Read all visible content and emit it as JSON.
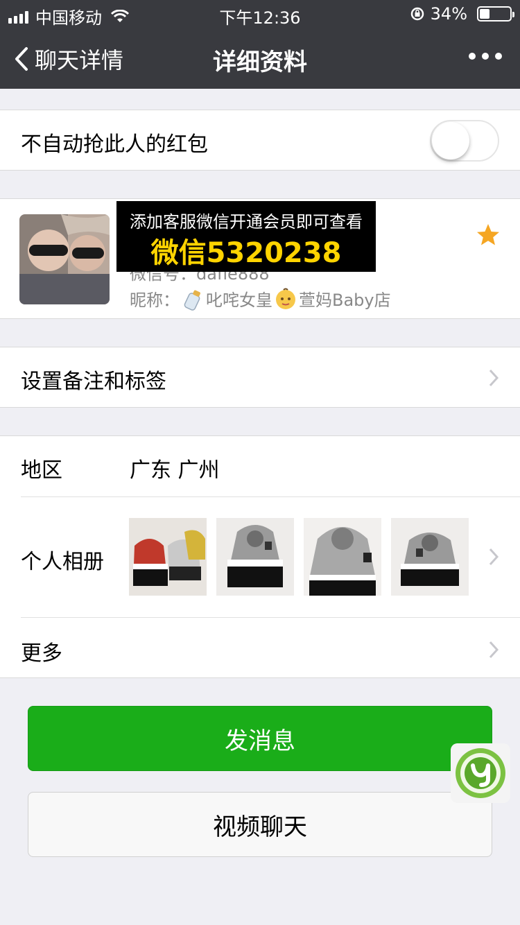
{
  "status_bar": {
    "carrier": "中国移动",
    "time": "下午12:36",
    "battery_percent": "34%",
    "battery_level": 0.34
  },
  "nav": {
    "back_label": "聊天详情",
    "title": "详细资料"
  },
  "red_packet": {
    "label": "不自动抢此人的红包",
    "enabled": false
  },
  "profile": {
    "wechat_id_prefix": "微信号：",
    "wechat_id_partial": "dafle888",
    "nickname_label": "昵称：",
    "nickname": "叱咤女皇",
    "nickname_suffix": "萱妈Baby店"
  },
  "overlay_ad": {
    "line1": "添加客服微信开通会员即可查看",
    "line2": "微信5320238"
  },
  "remark": {
    "label": "设置备注和标签"
  },
  "region": {
    "label": "地区",
    "value": "广东 广州"
  },
  "album": {
    "label": "个人相册"
  },
  "more": {
    "label": "更多"
  },
  "buttons": {
    "send_message": "发消息",
    "video_chat": "视频聊天"
  },
  "colors": {
    "navbar": "#393a3f",
    "primary_green": "#1aad19",
    "star": "#f5a623",
    "background": "#efeff4"
  }
}
